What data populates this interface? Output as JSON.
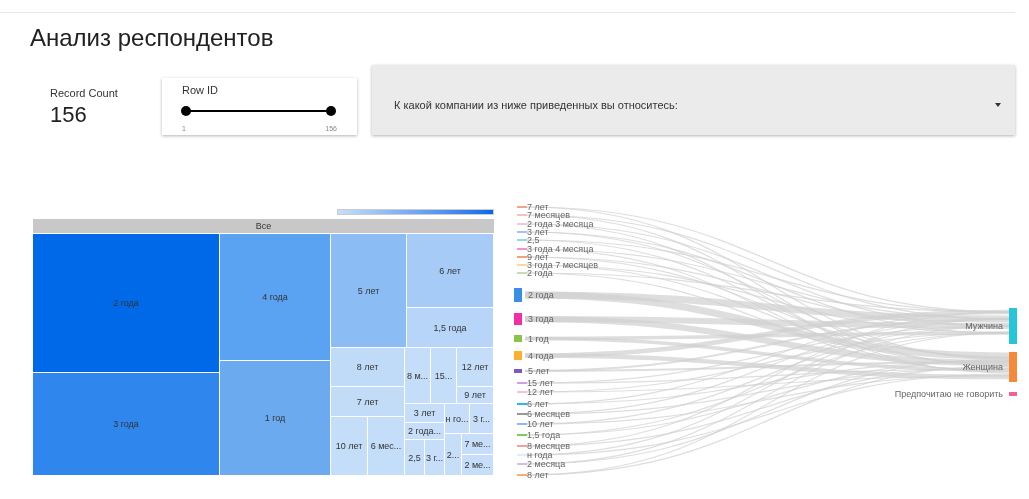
{
  "title": "Анализ респондентов",
  "record_count": {
    "label": "Record Count",
    "value": "156"
  },
  "row_id_filter": {
    "label": "Row ID",
    "min": "1",
    "max": "156",
    "thumbs": [
      {
        "level": 0
      },
      {
        "level": 1
      }
    ]
  },
  "dropdown": {
    "label": "К какой компании из ниже приведенных вы относитесь:"
  },
  "treemap": {
    "header": "Все",
    "tiles": [
      {
        "label": "2 года",
        "color": "#0069e8"
      },
      {
        "label": "3 года",
        "color": "#2f86ec"
      },
      {
        "label": "4 года",
        "color": "#5aa3f2"
      },
      {
        "label": "1 год",
        "color": "#6caaf0"
      },
      {
        "label": "5 лет",
        "color": "#8cbcf4"
      },
      {
        "label": "6 лет",
        "color": "#a6cbf6"
      },
      {
        "label": "1,5 года",
        "color": "#b7d5f8"
      },
      {
        "label": "8 лет",
        "color": "#c0dbf8"
      },
      {
        "label": "7 лет",
        "color": "#c2dcf8"
      },
      {
        "label": "10 лет",
        "color": "#c4ddf8"
      },
      {
        "label": "6 мес...",
        "color": "#c4ddf8"
      },
      {
        "label": "8 м...",
        "color": "#c4ddf8"
      },
      {
        "label": "15...",
        "color": "#c4ddf8"
      },
      {
        "label": "12 лет",
        "color": "#c4ddf8"
      },
      {
        "label": "9 лет",
        "color": "#c6def9"
      },
      {
        "label": "3 лет",
        "color": "#c6def9"
      },
      {
        "label": "2 года...",
        "color": "#c6def9"
      },
      {
        "label": "2,5",
        "color": "#c6def9"
      },
      {
        "label": "3 г...",
        "color": "#c6def9"
      },
      {
        "label": "н го...",
        "color": "#c6def9"
      },
      {
        "label": "3 г...",
        "color": "#c6def9"
      },
      {
        "label": "2...",
        "color": "#c6def9"
      },
      {
        "label": "7 ме...",
        "color": "#c6def9"
      },
      {
        "label": "2 ме...",
        "color": "#c6def9"
      }
    ]
  },
  "sankey": {
    "sources": [
      {
        "label": "7 лет",
        "kind": "line",
        "color": "#f4a582"
      },
      {
        "label": "7 месяцев",
        "kind": "line",
        "color": "#f8c0c0"
      },
      {
        "label": "2 года 3 месяца",
        "kind": "line",
        "color": "#f3c6d8"
      },
      {
        "label": "3 лет",
        "kind": "line",
        "color": "#9fc5f0"
      },
      {
        "label": "2,5",
        "kind": "line",
        "color": "#8ee0e0"
      },
      {
        "label": "3 года 4 месяца",
        "kind": "line",
        "color": "#f58fd0"
      },
      {
        "label": "9 лет",
        "kind": "line",
        "color": "#f4a070"
      },
      {
        "label": "3 года 7 месяцев",
        "kind": "line",
        "color": "#fbd9a0"
      },
      {
        "label": "2 года",
        "kind": "line",
        "color": "#c4e0b0"
      },
      {
        "label": "2 года",
        "kind": "bar",
        "color": "#3a8ee6"
      },
      {
        "label": "3 года",
        "kind": "bar",
        "color": "#ee2fa5"
      },
      {
        "label": "1 год",
        "kind": "bar",
        "color": "#8bc34a"
      },
      {
        "label": "4 года",
        "kind": "bar",
        "color": "#fbb030"
      },
      {
        "label": "5 лет",
        "kind": "bar",
        "color": "#7e57c2"
      },
      {
        "label": "15 лет",
        "kind": "line",
        "color": "#d0a0e0"
      },
      {
        "label": "12 лет",
        "kind": "line",
        "color": "#f8c0d0"
      },
      {
        "label": "6 лет",
        "kind": "line",
        "color": "#29b6f6"
      },
      {
        "label": "6 месяцев",
        "kind": "line",
        "color": "#999999"
      },
      {
        "label": "10 лет",
        "kind": "line",
        "color": "#90b8f0"
      },
      {
        "label": "1,5 года",
        "kind": "line",
        "color": "#7ccc60"
      },
      {
        "label": "8 месяцев",
        "kind": "line",
        "color": "#f4a0a0"
      },
      {
        "label": "н года",
        "kind": "line",
        "color": "#d8f0fa"
      },
      {
        "label": "2 месяца",
        "kind": "line",
        "color": "#d0c0e8"
      },
      {
        "label": "8 лет",
        "kind": "line",
        "color": "#f8b070"
      }
    ],
    "targets": [
      {
        "label": "Мужчина",
        "color": "#26c6da"
      },
      {
        "label": "Женщина",
        "color": "#f5893a"
      },
      {
        "label": "Предпочитаю не говорить",
        "color": "#f06292"
      }
    ]
  }
}
